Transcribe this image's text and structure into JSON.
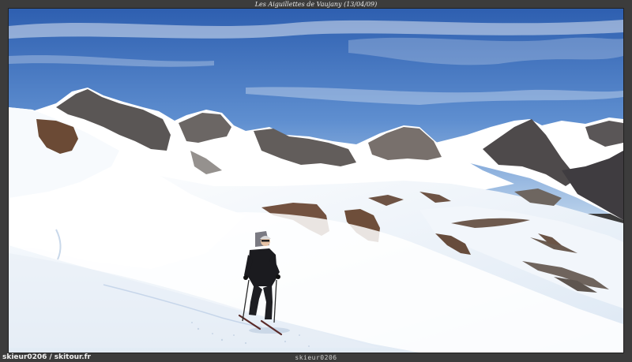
{
  "caption": "Les Aiguillettes de Vaujany (13/04/09)",
  "credits": {
    "author": "skieur0206",
    "separator": "/",
    "site": "skitour.fr"
  },
  "watermark": "skieur0206",
  "colors": {
    "frame": "#3c3c3c",
    "sky_top": "#2f63b5",
    "sky_bottom": "#a9c6e6",
    "snow": "#ffffff",
    "snow_shadow": "#cfdff0",
    "rock": "#5a5553",
    "grass_patch": "#6b4a35"
  }
}
